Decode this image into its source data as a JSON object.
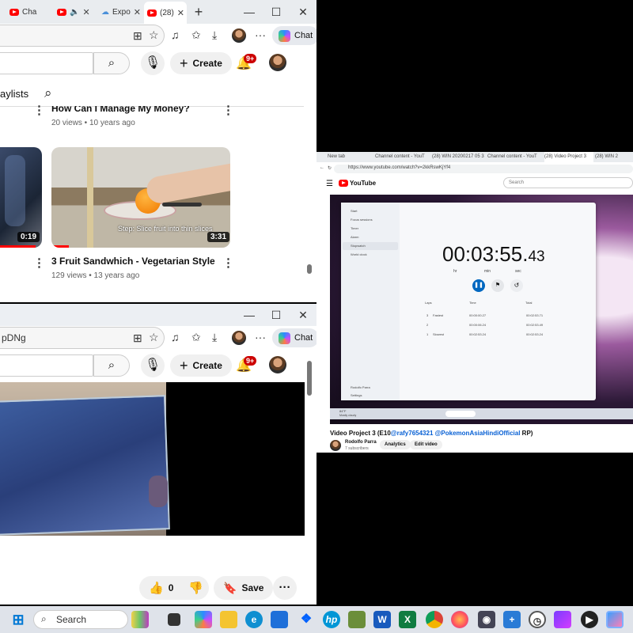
{
  "window1": {
    "tabs": [
      "Cha",
      "",
      "Expo",
      "(28)"
    ],
    "search_bar_text": "",
    "create_label": "Create",
    "notif_badge": "9+",
    "playlists_label": "aylists",
    "top_video": {
      "title": "How Can I Manage My Money?",
      "meta": "20 views • 10 years ago"
    },
    "left_duration": "0:19",
    "video": {
      "title": "3 Fruit Sandwhich - Vegetarian Style",
      "meta": "129 views • 13 years ago",
      "duration": "3:31",
      "step_text": "Step: Slice fruit into thin slices"
    }
  },
  "chat_label": "Chat",
  "window2": {
    "addr_text": "pDNg",
    "create_label": "Create",
    "notif_badge": "9+",
    "like_count": "0",
    "save_label": "Save"
  },
  "right": {
    "tabs": [
      "New tab",
      "Channel content - YouT",
      "(28) WIN 20200217 05 3",
      "Channel content - YouT",
      "(28) Video Project 3",
      "(28) WIN 2"
    ],
    "url": "https://www.youtube.com/watch?v=2kkRswKjYf4",
    "yt_logo": "YouTube",
    "search_placeholder": "Search",
    "stopwatch": {
      "time": "00:03:55.",
      "centis": "43",
      "labels": [
        "hr",
        "min",
        "sec"
      ],
      "menu": [
        "Start",
        "Focus sessions",
        "Timer",
        "Alarm",
        "Stopwatch",
        "World clock"
      ],
      "user": "Rodolfo Parra",
      "settings": "Settings",
      "lap_headers": [
        "Laps",
        "Time",
        "Total"
      ],
      "laps": [
        {
          "n": "3",
          "tag": "Fastest",
          "time": "00:00:00.27",
          "total": "00:02:53.71"
        },
        {
          "n": "2",
          "tag": "",
          "time": "00:00:06.24",
          "total": "00:02:53.49"
        },
        {
          "n": "1",
          "tag": "Slowest",
          "time": "00:02:53.24",
          "total": "00:02:53.24"
        }
      ],
      "weather": "84°F",
      "weather_sub": "Mostly cloudy"
    },
    "video_title_prefix": "Video Project 3 (E10",
    "video_title_link1": "@rafy7654321",
    "video_title_link2": " @PokemonAsiaHindiOfficial",
    "video_title_suffix": " RP)",
    "channel": "Rodolfo Parra",
    "subs": "7 subscribers",
    "analytics": "Analytics",
    "edit": "Edit video"
  },
  "taskbar": {
    "search": "Search"
  },
  "colors": {
    "youtube_red": "#ff0000",
    "link_blue": "#065fd4",
    "stopwatch_accent": "#0067c0"
  }
}
